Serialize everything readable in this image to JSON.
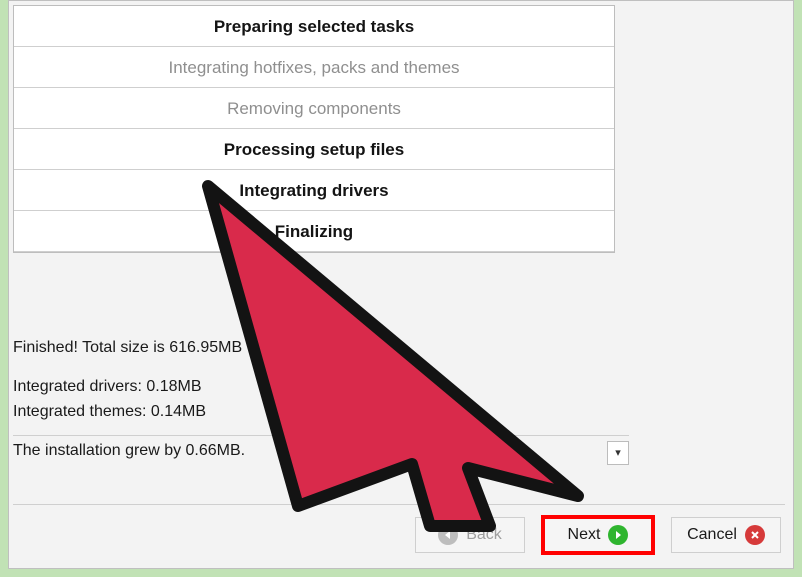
{
  "tasks": [
    {
      "label": "Preparing selected tasks",
      "state": "active"
    },
    {
      "label": "Integrating hotfixes, packs and themes",
      "state": "inactive"
    },
    {
      "label": "Removing components",
      "state": "inactive"
    },
    {
      "label": "Processing setup files",
      "state": "active"
    },
    {
      "label": "Integrating drivers",
      "state": "active"
    },
    {
      "label": "Finalizing",
      "state": "active"
    }
  ],
  "status": {
    "finished": "Finished! Total size is 616.95MB",
    "drivers": "Integrated drivers: 0.18MB",
    "themes": "Integrated themes: 0.14MB",
    "grew": "The installation grew by 0.66MB."
  },
  "buttons": {
    "back": "Back",
    "next": "Next",
    "cancel": "Cancel"
  },
  "annotation": {
    "highlight_target": "next-button",
    "colors": {
      "arrow_fill": "#d92a4b",
      "arrow_stroke": "#131313",
      "highlight": "#ff0000"
    }
  }
}
